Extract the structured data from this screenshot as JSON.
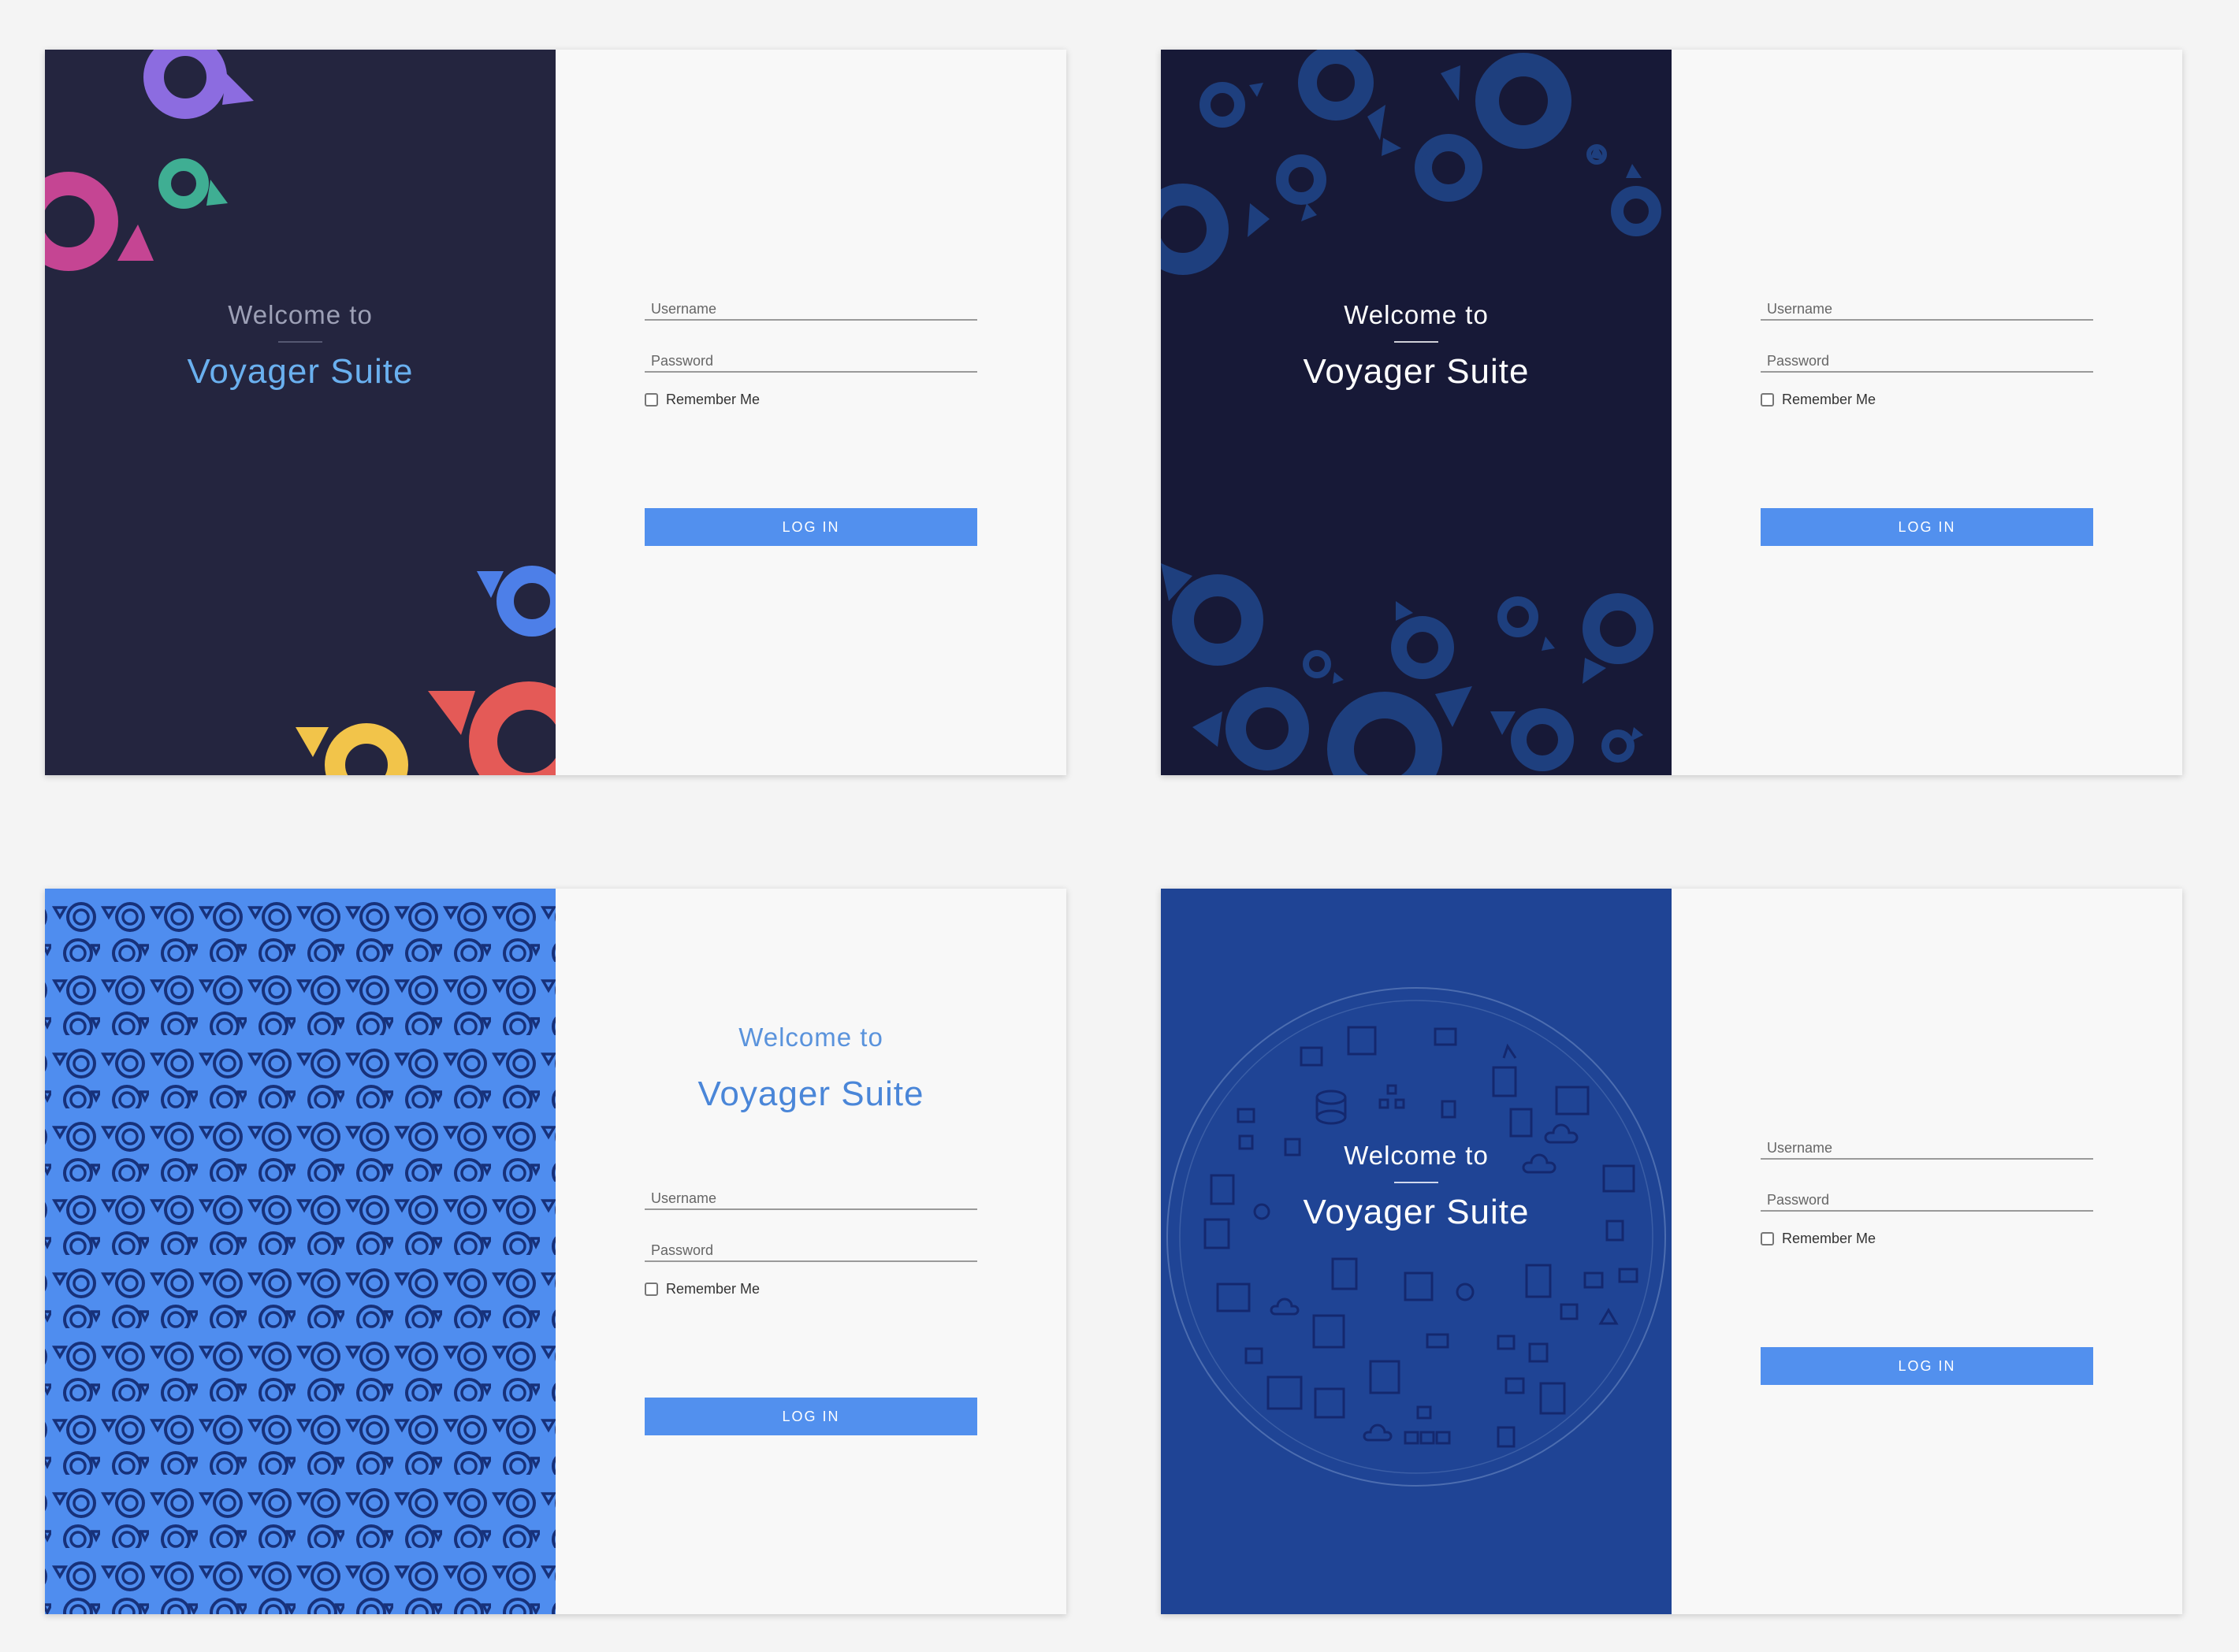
{
  "screens": [
    {
      "welcome_to": "Welcome to",
      "title": "Voyager Suite",
      "username_placeholder": "Username",
      "password_placeholder": "Password",
      "remember_label": "Remember Me",
      "login_label": "LOG IN",
      "panel_color": "#24253f"
    },
    {
      "welcome_to": "Welcome to",
      "title": "Voyager Suite",
      "username_placeholder": "Username",
      "password_placeholder": "Password",
      "remember_label": "Remember Me",
      "login_label": "LOG IN",
      "panel_color": "#171937"
    },
    {
      "welcome_to": "Welcome to",
      "title": "Voyager Suite",
      "username_placeholder": "Username",
      "password_placeholder": "Password",
      "remember_label": "Remember Me",
      "login_label": "LOG IN",
      "panel_color": "#4f8def"
    },
    {
      "welcome_to": "Welcome to",
      "title": "Voyager Suite",
      "username_placeholder": "Username",
      "password_placeholder": "Password",
      "remember_label": "Remember Me",
      "login_label": "LOG IN",
      "panel_color": "#1f4495"
    }
  ],
  "colors": {
    "button": "#5290ee",
    "accent_light_blue": "#6ab0ef",
    "accent_blue": "#4a86d8"
  }
}
